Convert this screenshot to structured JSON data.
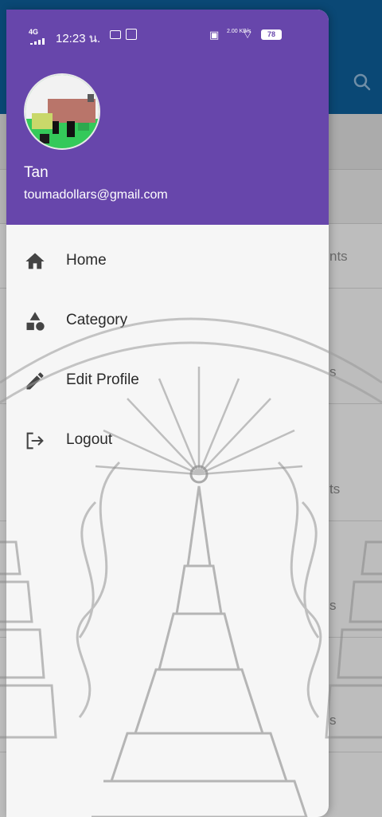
{
  "status_bar": {
    "network": "4G",
    "time": "12:23 น.",
    "speed": "2.00 KB/s",
    "battery": "78"
  },
  "drawer": {
    "user": {
      "name": "Tan",
      "email": "toumadollars@gmail.com"
    },
    "menu": [
      {
        "label": "Home",
        "icon": "home-icon"
      },
      {
        "label": "Category",
        "icon": "category-icon"
      },
      {
        "label": "Edit Profile",
        "icon": "edit-icon"
      },
      {
        "label": "Logout",
        "icon": "logout-icon"
      }
    ]
  },
  "background": {
    "rows": [
      "nts",
      "s",
      "ts",
      "s",
      "s"
    ]
  },
  "colors": {
    "drawer_header": "#6746ab",
    "app_bar": "#0e5d96",
    "drawer_body": "#f6f6f6"
  }
}
